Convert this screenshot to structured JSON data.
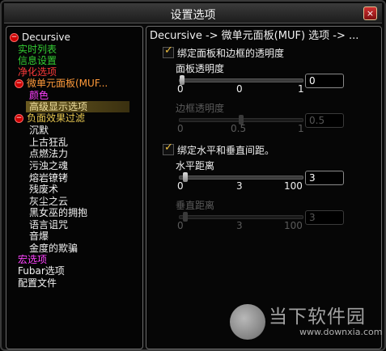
{
  "window": {
    "title": "设置选项",
    "close_glyph": "×"
  },
  "tree": {
    "items": [
      {
        "label": "Decursive"
      },
      {
        "label": "实时列表"
      },
      {
        "label": "信息设置"
      },
      {
        "label": "净化选项"
      },
      {
        "label": "微单元面板(MUF..."
      },
      {
        "label": "颜色"
      },
      {
        "label": "高级显示选项"
      },
      {
        "label": "负面效果过滤"
      },
      {
        "label": "沉默"
      },
      {
        "label": "上古狂乱"
      },
      {
        "label": "点燃法力"
      },
      {
        "label": "污浊之魂"
      },
      {
        "label": "熔岩镣铐"
      },
      {
        "label": "残废术"
      },
      {
        "label": "灰尘之云"
      },
      {
        "label": "黑女巫的拥抱"
      },
      {
        "label": "语言诅咒"
      },
      {
        "label": "音爆"
      },
      {
        "label": "金度的欺骗"
      },
      {
        "label": "宏选项"
      },
      {
        "label": "Fubar选项"
      },
      {
        "label": "配置文件"
      }
    ]
  },
  "panel": {
    "breadcrumb": "Decursive -> 微单元面板(MUF) 选项 -> ...",
    "opacity_group": {
      "checkbox_label": "绑定面板和边框的透明度",
      "checked": true,
      "sliders": [
        {
          "label": "面板透明度",
          "min": "0",
          "mid": "0",
          "max": "1",
          "value": "0",
          "level": 0.0,
          "enabled": true
        },
        {
          "label": "边框透明度",
          "min": "0",
          "mid": "0.5",
          "max": "1",
          "value": "0.5",
          "level": 0.5,
          "enabled": false
        }
      ]
    },
    "spacing_group": {
      "checkbox_label": "绑定水平和垂直间距。",
      "checked": true,
      "sliders": [
        {
          "label": "水平距离",
          "min": "0",
          "mid": "3",
          "max": "100",
          "value": "3",
          "level": 0.03,
          "enabled": true
        },
        {
          "label": "垂直距离",
          "min": "0",
          "mid": "3",
          "max": "100",
          "value": "3",
          "level": 0.03,
          "enabled": false
        }
      ]
    }
  },
  "watermark": {
    "text": "当下软件园",
    "url": "www.downxia.com",
    "logo_text": "Win"
  }
}
